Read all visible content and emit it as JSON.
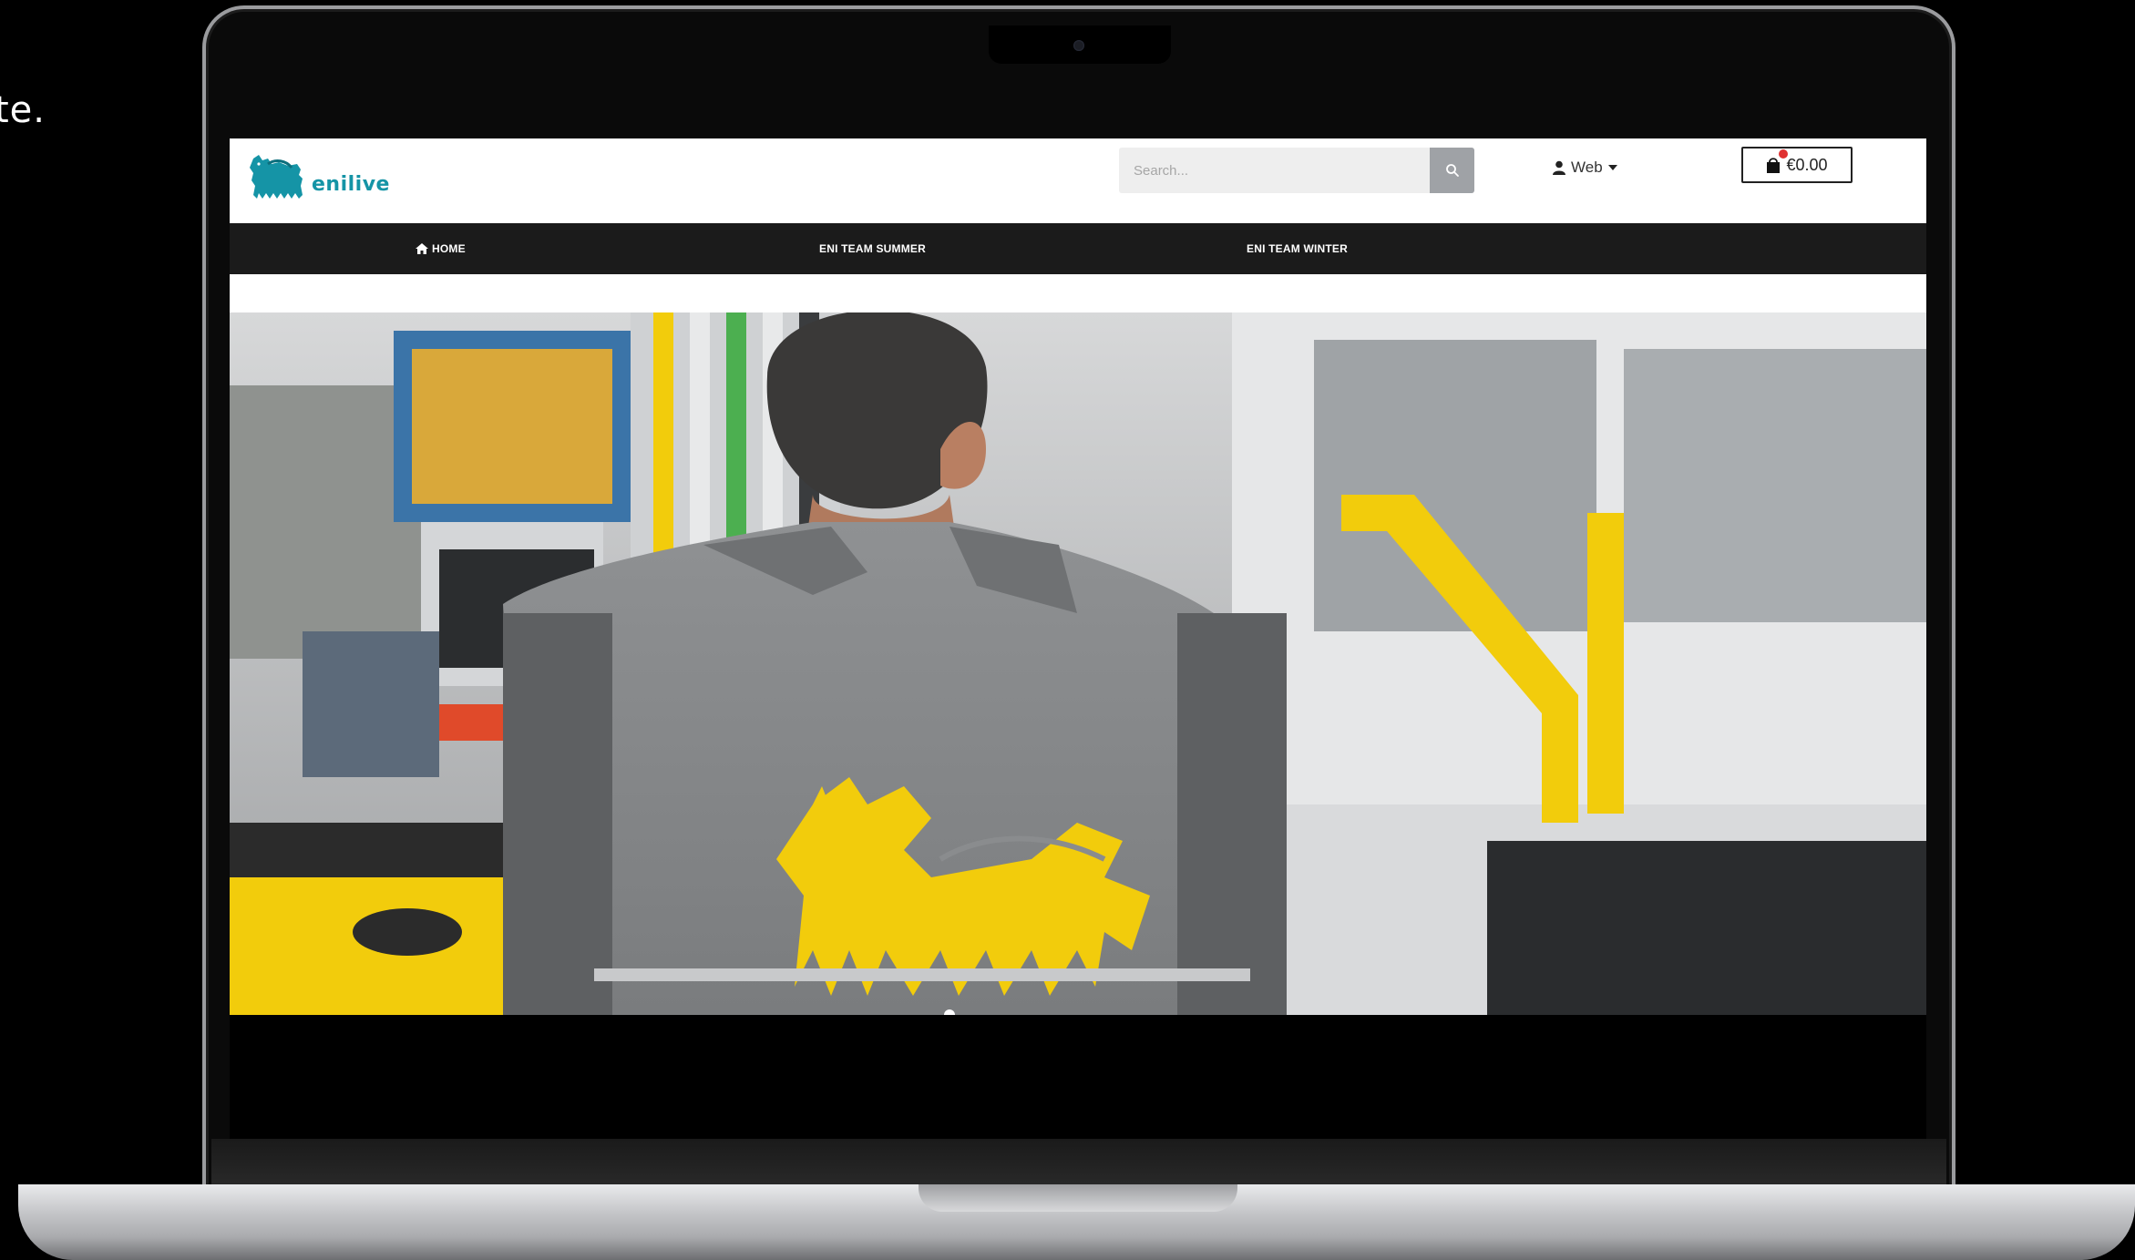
{
  "side_text": "te.",
  "brand": {
    "logo_text": "enilive",
    "accent": "#1594a6",
    "yellow": "#f2cc0c"
  },
  "search": {
    "placeholder": "Search...",
    "icon": "search-icon"
  },
  "account": {
    "label": "Web",
    "icon": "user-icon",
    "caret": "caret-down-icon"
  },
  "cart": {
    "total": "€0.00",
    "icon": "shopping-bag-icon"
  },
  "nav": {
    "items": [
      {
        "label": "HOME",
        "icon": "home-icon"
      },
      {
        "label": "ENI TEAM SUMMER"
      },
      {
        "label": "ENI TEAM WINTER"
      }
    ]
  },
  "hero": {
    "description_icon": "eni-six-legged-dog-emblem"
  }
}
